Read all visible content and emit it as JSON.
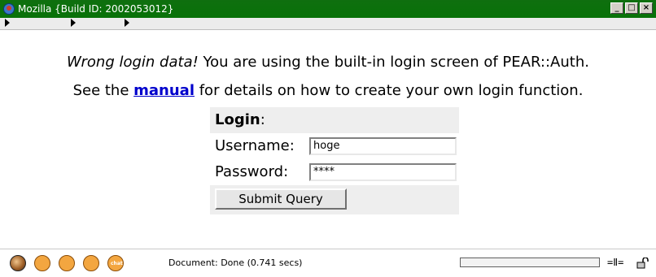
{
  "window": {
    "title": "Mozilla {Build ID: 2002053012}",
    "buttons": {
      "minimize": "_",
      "maximize": "□",
      "close": "×"
    }
  },
  "message": {
    "line1_em": "Wrong login data!",
    "line1_rest": " You are using the built-in login screen of PEAR::Auth.",
    "line2_before": "See the ",
    "line2_link": "manual",
    "line2_after": " for details on how to create your own login function."
  },
  "form": {
    "header_bold": "Login",
    "header_colon": ":",
    "username_label": "Username:",
    "username_value": "hoge",
    "password_label": "Password:",
    "password_value": "****",
    "submit_label": "Submit Query"
  },
  "statusbar": {
    "status_text": "Document: Done (0.741 secs)",
    "progress_percent": 0,
    "icons": [
      "navigator-icon",
      "mail-icon",
      "composer-icon",
      "addressbook-icon",
      "chat-icon",
      "online-icon",
      "lock-icon"
    ],
    "chat_icon_text": "chat",
    "online_icon_text": "=Ⅱ="
  },
  "colors": {
    "titlebar": "#087208",
    "link": "#0000cc",
    "form_bg": "#eeeeee"
  }
}
